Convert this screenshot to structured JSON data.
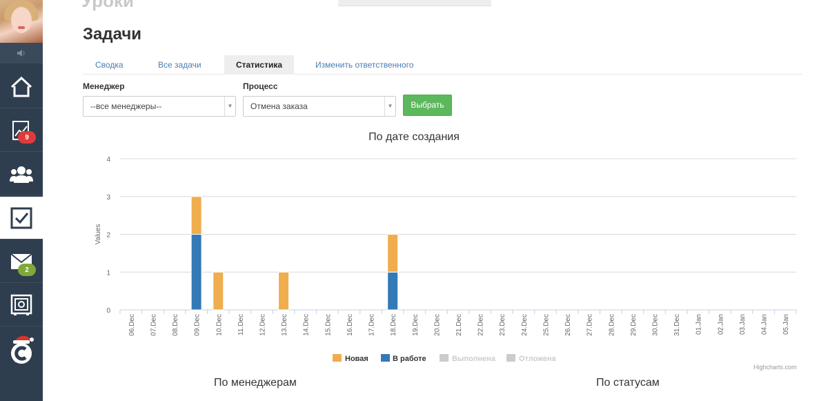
{
  "header": {
    "brand_fragment": "Уроки",
    "page_title": "Задачи"
  },
  "sidebar": {
    "items": [
      {
        "icon": "home-icon",
        "badge": ""
      },
      {
        "icon": "chart-icon",
        "badge": "9",
        "badge_color": "#e03b3b"
      },
      {
        "icon": "users-icon",
        "badge": ""
      },
      {
        "icon": "checkbox-icon",
        "badge": "",
        "active": true
      },
      {
        "icon": "mail-icon",
        "badge": "2",
        "badge_color": "#7ea83a"
      },
      {
        "icon": "safe-icon",
        "badge": ""
      },
      {
        "icon": "logo-santa-icon",
        "badge": ""
      }
    ]
  },
  "tabs": [
    {
      "label": "Сводка",
      "active": false
    },
    {
      "label": "Все задачи",
      "active": false
    },
    {
      "label": "Статистика",
      "active": true
    },
    {
      "label": "Изменить ответственного",
      "active": false
    }
  ],
  "filters": {
    "manager_label": "Менеджер",
    "manager_value": "--все менеджеры--",
    "process_label": "Процесс",
    "process_value": "Отмена заказа",
    "submit_label": "Выбрать"
  },
  "chart_data": {
    "type": "bar",
    "stacked": true,
    "title": "По дате создания",
    "xlabel": "",
    "ylabel": "Values",
    "ylim": [
      0,
      4
    ],
    "yticks": [
      0,
      1,
      2,
      3,
      4
    ],
    "grid": true,
    "legend": "bottom-center",
    "categories": [
      "06.Dec",
      "07.Dec",
      "08.Dec",
      "09.Dec",
      "10.Dec",
      "11.Dec",
      "12.Dec",
      "13.Dec",
      "14.Dec",
      "15.Dec",
      "16.Dec",
      "17.Dec",
      "18.Dec",
      "19.Dec",
      "20.Dec",
      "21.Dec",
      "22.Dec",
      "23.Dec",
      "24.Dec",
      "25.Dec",
      "26.Dec",
      "27.Dec",
      "28.Dec",
      "29.Dec",
      "30.Dec",
      "31.Dec",
      "01.Jan",
      "02.Jan",
      "03.Jan",
      "04.Jan",
      "05.Jan"
    ],
    "series": [
      {
        "name": "Новая",
        "color": "#f0ad4e",
        "visible": true,
        "values": [
          0,
          0,
          0,
          1,
          1,
          0,
          0,
          1,
          0,
          0,
          0,
          0,
          1,
          0,
          0,
          0,
          0,
          0,
          0,
          0,
          0,
          0,
          0,
          0,
          0,
          0,
          0,
          0,
          0,
          0,
          0
        ]
      },
      {
        "name": "В работе",
        "color": "#337ab7",
        "visible": true,
        "values": [
          0,
          0,
          0,
          2,
          0,
          0,
          0,
          0,
          0,
          0,
          0,
          0,
          1,
          0,
          0,
          0,
          0,
          0,
          0,
          0,
          0,
          0,
          0,
          0,
          0,
          0,
          0,
          0,
          0,
          0,
          0
        ]
      },
      {
        "name": "Выполнена",
        "color": "#cccccc",
        "visible": false,
        "values": []
      },
      {
        "name": "Отложена",
        "color": "#cccccc",
        "visible": false,
        "values": []
      }
    ],
    "credits": "Highcharts.com"
  },
  "sections": {
    "by_managers": "По менеджерам",
    "by_statuses": "По статусам"
  }
}
